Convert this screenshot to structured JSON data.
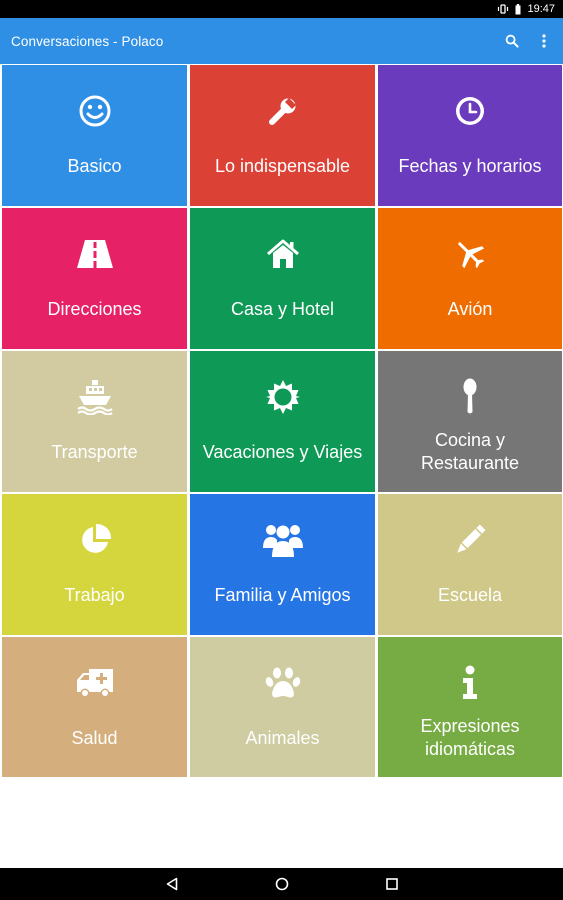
{
  "status_bar": {
    "time": "19:47"
  },
  "app_bar": {
    "title": "Conversaciones - Polaco"
  },
  "tiles": [
    {
      "label": "Basico",
      "icon": "smiley-icon",
      "color": "#2f8fe5"
    },
    {
      "label": "Lo indispensable",
      "icon": "wrench-icon",
      "color": "#dc4136"
    },
    {
      "label": "Fechas y horarios",
      "icon": "clock-icon",
      "color": "#6a3bbd"
    },
    {
      "label": "Direcciones",
      "icon": "road-icon",
      "color": "#e62165"
    },
    {
      "label": "Casa y Hotel",
      "icon": "home-icon",
      "color": "#0e9a56"
    },
    {
      "label": "Avión",
      "icon": "airplane-icon",
      "color": "#ef6c00"
    },
    {
      "label": "Transporte",
      "icon": "ship-icon",
      "color": "#d2cba1"
    },
    {
      "label": "Vacaciones y Viajes",
      "icon": "sun-icon",
      "color": "#0e9a56"
    },
    {
      "label": "Cocina y\nRestaurante",
      "icon": "spoon-icon",
      "color": "#767676"
    },
    {
      "label": "Trabajo",
      "icon": "pie-chart-icon",
      "color": "#d5d63d"
    },
    {
      "label": "Familia y Amigos",
      "icon": "group-icon",
      "color": "#2575e4"
    },
    {
      "label": "Escuela",
      "icon": "pencil-icon",
      "color": "#d0c888"
    },
    {
      "label": "Salud",
      "icon": "ambulance-icon",
      "color": "#d4ae7c"
    },
    {
      "label": "Animales",
      "icon": "paw-icon",
      "color": "#cfcca1"
    },
    {
      "label": "Expresiones\nidiomáticas",
      "icon": "info-icon",
      "color": "#77ab44"
    }
  ],
  "nav_bar": {
    "back": "back-icon",
    "home": "home-circle-icon",
    "recents": "recents-icon"
  }
}
